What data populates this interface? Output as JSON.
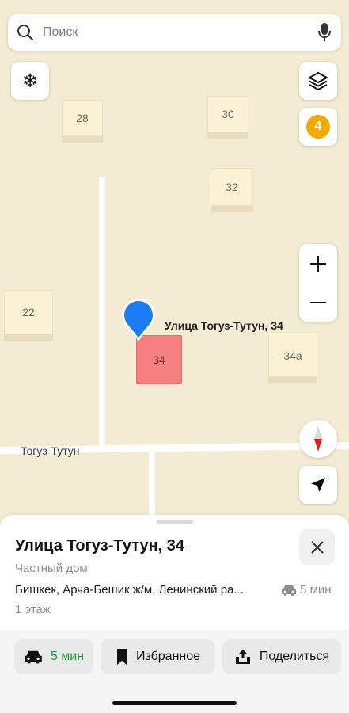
{
  "search": {
    "placeholder": "Поиск"
  },
  "map_controls": {
    "layers_badge_count": "4"
  },
  "buildings": [
    {
      "label": "28"
    },
    {
      "label": "30"
    },
    {
      "label": "32"
    },
    {
      "label": "22"
    },
    {
      "label": "34"
    },
    {
      "label": "34a"
    }
  ],
  "street_label": "Тогуз-Тутун",
  "pin_label": "Улица Тогуз-Тутун, 34",
  "place": {
    "title": "Улица Тогуз-Тутун, 34",
    "type": "Частный дом",
    "address": "Бишкек, Арча-Бешик ж/м, Ленинский ра...",
    "drive_time": "5 мин",
    "floors": "1 этаж"
  },
  "actions": {
    "route": "5 мин",
    "favorite": "Избранное",
    "share": "Поделиться"
  },
  "colors": {
    "accent_blue": "#1a7df5",
    "green": "#1f9a3a",
    "badge": "#f2a900",
    "selected_building": "#f58080"
  }
}
